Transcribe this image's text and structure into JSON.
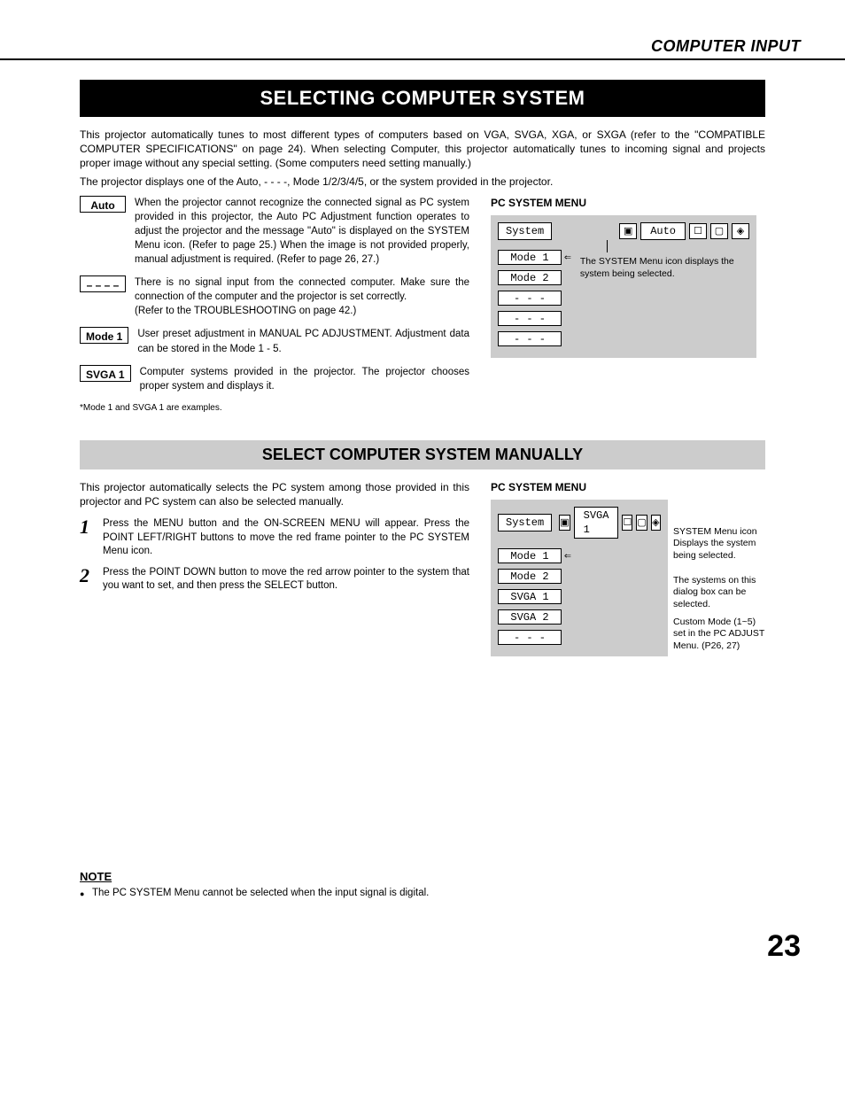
{
  "header": {
    "section": "COMPUTER INPUT"
  },
  "banner1": "SELECTING COMPUTER SYSTEM",
  "intro": {
    "p1": "This projector automatically tunes to most different types of computers based on VGA, SVGA, XGA, or SXGA (refer to the \"COMPATIBLE COMPUTER SPECIFICATIONS\" on page 24).  When selecting Computer, this projector automatically tunes to incoming signal and projects proper image without any special setting.  (Some computers need setting manually.)",
    "p2": "The projector displays one of the Auto, - - - -, Mode 1/2/3/4/5, or the system provided in the projector."
  },
  "defs": {
    "auto": {
      "label": "Auto",
      "text": "When the projector cannot recognize the connected signal as PC system provided in this projector, the Auto PC Adjustment function operates to adjust the projector and the message \"Auto\" is displayed on the SYSTEM Menu icon.  (Refer to page 25.)  When the image is not provided properly, manual adjustment is required.  (Refer to page 26, 27.)"
    },
    "dashes": {
      "label": "– – – –",
      "text": "There is no signal input from the connected computer.  Make sure the connection of the computer and the projector is set correctly.\n(Refer to the TROUBLESHOOTING on page 42.)"
    },
    "mode1": {
      "label": "Mode 1",
      "text": "User preset adjustment in MANUAL PC ADJUSTMENT.  Adjustment data can be stored in the Mode 1 - 5."
    },
    "svga1": {
      "label": "SVGA 1",
      "text": "Computer systems provided in the projector.  The projector chooses proper system and displays it."
    }
  },
  "footnote": "*Mode 1 and SVGA 1 are examples.",
  "menu1": {
    "title": "PC SYSTEM MENU",
    "system_label": "System",
    "selected": "Auto",
    "items": [
      "Mode 1",
      "Mode 2",
      "- - -",
      "- - -",
      "- - -"
    ],
    "callout": "The SYSTEM Menu icon displays the system being selected."
  },
  "banner2": "SELECT COMPUTER SYSTEM MANUALLY",
  "manual_intro": "This projector automatically selects the PC system among those provided in this projector and PC system can also be selected manually.",
  "steps": {
    "s1": {
      "num": "1",
      "text": "Press the MENU button and the ON-SCREEN MENU will appear.  Press the POINT LEFT/RIGHT buttons to move the red frame pointer to the PC SYSTEM Menu icon."
    },
    "s2": {
      "num": "2",
      "text": "Press the POINT DOWN button to move the red arrow pointer to the system that you want to set, and then press the SELECT button."
    }
  },
  "menu2": {
    "title": "PC SYSTEM MENU",
    "system_label": "System",
    "selected": "SVGA 1",
    "items": [
      "Mode 1",
      "Mode 2",
      "SVGA 1",
      "SVGA 2",
      "- - -"
    ],
    "callout1": "SYSTEM Menu icon\nDisplays the system being selected.",
    "callout2": "The systems on this dialog box can be selected.",
    "callout3": "Custom Mode (1~5) set in the PC ADJUST Menu.  (P26, 27)"
  },
  "note": {
    "title": "NOTE",
    "text": "The PC SYSTEM Menu cannot be selected when the input signal is digital."
  },
  "page_number": "23"
}
